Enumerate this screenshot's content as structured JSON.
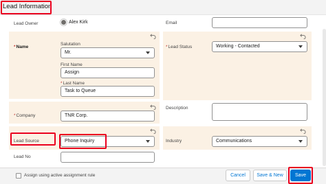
{
  "section": {
    "title": "Lead Information"
  },
  "fields": {
    "lead_owner": {
      "label": "Lead Owner",
      "value": "Alex Kirk"
    },
    "email": {
      "label": "Email",
      "value": ""
    },
    "name": {
      "label": "Name",
      "salutation": {
        "label": "Salutation",
        "value": "Mr."
      },
      "first_name": {
        "label": "First Name",
        "value": "Assign"
      },
      "last_name": {
        "label": "Last Name",
        "value": "Task to Queue"
      }
    },
    "lead_status": {
      "label": "Lead Status",
      "value": "Working - Contacted"
    },
    "company": {
      "label": "Company",
      "value": "TNR Corp."
    },
    "description": {
      "label": "Description",
      "value": ""
    },
    "lead_source": {
      "label": "Lead Source",
      "value": "Phone Inquiry"
    },
    "industry": {
      "label": "Industry",
      "value": "Communications"
    },
    "lead_no": {
      "label": "Lead No",
      "value": ""
    }
  },
  "footer": {
    "checkbox_label": "Assign using active assignment rule",
    "checkbox_checked": false,
    "cancel": "Cancel",
    "save_new": "Save & New",
    "save": "Save"
  },
  "colors": {
    "highlight": "#ea001e",
    "brand": "#0176d3",
    "edited_field_bg": "#fbf1e4"
  },
  "icons": [
    "user-avatar-icon",
    "undo-icon",
    "chevron-down-icon"
  ]
}
